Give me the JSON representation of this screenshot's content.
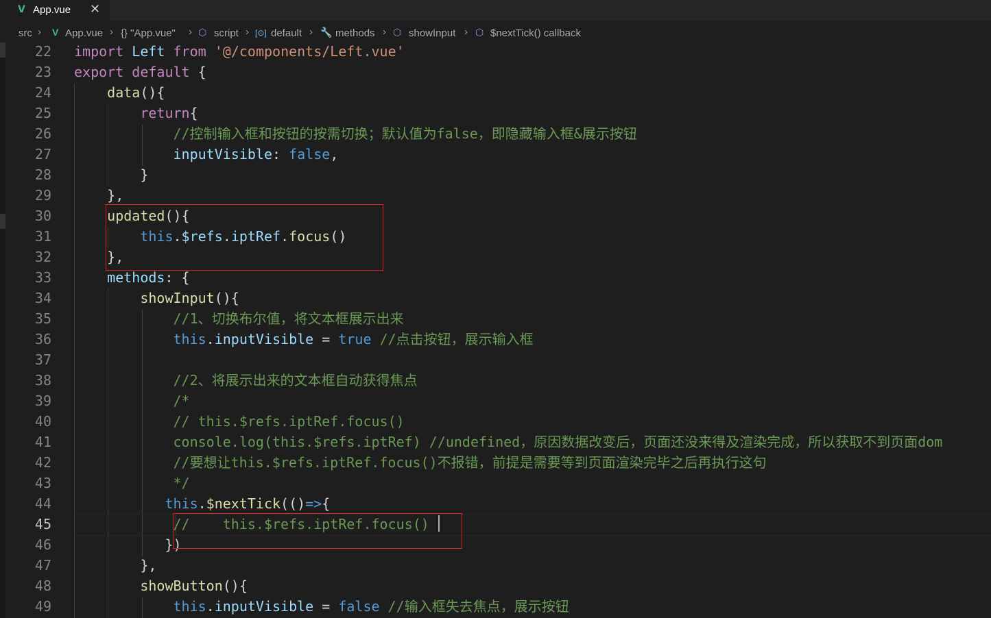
{
  "tab": {
    "label": "App.vue",
    "close": "✕",
    "vue_glyph": "V"
  },
  "breadcrumb": {
    "items": [
      "src",
      "App.vue",
      "{} \"App.vue\"",
      "script",
      "default",
      "methods",
      "showInput",
      "$nextTick() callback"
    ]
  },
  "lines": [
    {
      "n": "22",
      "tokens": [
        [
          "kw",
          "import"
        ],
        [
          "p",
          " "
        ],
        [
          "var",
          "Left"
        ],
        [
          "p",
          " "
        ],
        [
          "kw",
          "from"
        ],
        [
          "p",
          " "
        ],
        [
          "str",
          "'@/components/Left.vue'"
        ]
      ]
    },
    {
      "n": "23",
      "tokens": [
        [
          "kw",
          "export"
        ],
        [
          "p",
          " "
        ],
        [
          "kw",
          "default"
        ],
        [
          "p",
          " {"
        ]
      ]
    },
    {
      "n": "24",
      "tokens": [
        [
          "p",
          "    "
        ],
        [
          "fn",
          "data"
        ],
        [
          "p",
          "(){"
        ]
      ]
    },
    {
      "n": "25",
      "tokens": [
        [
          "p",
          "        "
        ],
        [
          "kw",
          "return"
        ],
        [
          "p",
          "{"
        ]
      ]
    },
    {
      "n": "26",
      "tokens": [
        [
          "p",
          "            "
        ],
        [
          "cm",
          "//控制输入框和按钮的按需切换；默认值为false，即隐藏输入框&展示按钮"
        ]
      ]
    },
    {
      "n": "27",
      "tokens": [
        [
          "p",
          "            "
        ],
        [
          "var",
          "inputVisible"
        ],
        [
          "p",
          ": "
        ],
        [
          "bool",
          "false"
        ],
        [
          "p",
          ","
        ]
      ]
    },
    {
      "n": "28",
      "tokens": [
        [
          "p",
          "        }"
        ]
      ]
    },
    {
      "n": "29",
      "tokens": [
        [
          "p",
          "    },"
        ]
      ]
    },
    {
      "n": "30",
      "tokens": [
        [
          "p",
          "    "
        ],
        [
          "fn",
          "updated"
        ],
        [
          "p",
          "(){"
        ]
      ]
    },
    {
      "n": "31",
      "tokens": [
        [
          "p",
          "        "
        ],
        [
          "this",
          "this"
        ],
        [
          "p",
          "."
        ],
        [
          "var",
          "$refs"
        ],
        [
          "p",
          "."
        ],
        [
          "var",
          "iptRef"
        ],
        [
          "p",
          "."
        ],
        [
          "fn",
          "focus"
        ],
        [
          "p",
          "()"
        ]
      ]
    },
    {
      "n": "32",
      "tokens": [
        [
          "p",
          "    },"
        ]
      ]
    },
    {
      "n": "33",
      "tokens": [
        [
          "p",
          "    "
        ],
        [
          "var",
          "methods"
        ],
        [
          "p",
          ": {"
        ]
      ]
    },
    {
      "n": "34",
      "tokens": [
        [
          "p",
          "        "
        ],
        [
          "fn",
          "showInput"
        ],
        [
          "p",
          "(){"
        ]
      ]
    },
    {
      "n": "35",
      "tokens": [
        [
          "p",
          "            "
        ],
        [
          "cm",
          "//1、切换布尔值，将文本框展示出来"
        ]
      ]
    },
    {
      "n": "36",
      "tokens": [
        [
          "p",
          "            "
        ],
        [
          "this",
          "this"
        ],
        [
          "p",
          "."
        ],
        [
          "var",
          "inputVisible"
        ],
        [
          "p",
          " = "
        ],
        [
          "bool",
          "true"
        ],
        [
          "p",
          " "
        ],
        [
          "cm",
          "//点击按钮，展示输入框"
        ]
      ]
    },
    {
      "n": "37",
      "tokens": []
    },
    {
      "n": "38",
      "tokens": [
        [
          "p",
          "            "
        ],
        [
          "cm",
          "//2、将展示出来的文本框自动获得焦点"
        ]
      ]
    },
    {
      "n": "39",
      "tokens": [
        [
          "p",
          "            "
        ],
        [
          "cm",
          "/*"
        ]
      ]
    },
    {
      "n": "40",
      "tokens": [
        [
          "p",
          "            "
        ],
        [
          "cm",
          "// this.$refs.iptRef.focus()"
        ]
      ]
    },
    {
      "n": "41",
      "tokens": [
        [
          "p",
          "            "
        ],
        [
          "cm",
          "console.log(this.$refs.iptRef) //undefined，原因数据改变后，页面还没来得及渲染完成，所以获取不到页面dom"
        ]
      ]
    },
    {
      "n": "42",
      "tokens": [
        [
          "p",
          "            "
        ],
        [
          "cm",
          "//要想让this.$refs.iptRef.focus()不报错，前提是需要等到页面渲染完毕之后再执行这句"
        ]
      ]
    },
    {
      "n": "43",
      "tokens": [
        [
          "p",
          "            "
        ],
        [
          "cm",
          "*/"
        ]
      ]
    },
    {
      "n": "44",
      "tokens": [
        [
          "p",
          "           "
        ],
        [
          "this",
          "this"
        ],
        [
          "p",
          "."
        ],
        [
          "fn",
          "$nextTick"
        ],
        [
          "p",
          "(()"
        ],
        [
          "bool",
          "=>"
        ],
        [
          "p",
          "{"
        ]
      ]
    },
    {
      "n": "45",
      "tokens": [
        [
          "p",
          "            "
        ],
        [
          "cm",
          "//    this.$refs.iptRef.focus()"
        ]
      ]
    },
    {
      "n": "46",
      "tokens": [
        [
          "p",
          "           })"
        ]
      ]
    },
    {
      "n": "47",
      "tokens": [
        [
          "p",
          "        },"
        ]
      ]
    },
    {
      "n": "48",
      "tokens": [
        [
          "p",
          "        "
        ],
        [
          "fn",
          "showButton"
        ],
        [
          "p",
          "(){"
        ]
      ]
    },
    {
      "n": "49",
      "tokens": [
        [
          "p",
          "            "
        ],
        [
          "this",
          "this"
        ],
        [
          "p",
          "."
        ],
        [
          "var",
          "inputVisible"
        ],
        [
          "p",
          " = "
        ],
        [
          "bool",
          "false"
        ],
        [
          "p",
          " "
        ],
        [
          "cm",
          "//输入框失去焦点，展示按钮"
        ]
      ]
    }
  ],
  "active_line": "45"
}
